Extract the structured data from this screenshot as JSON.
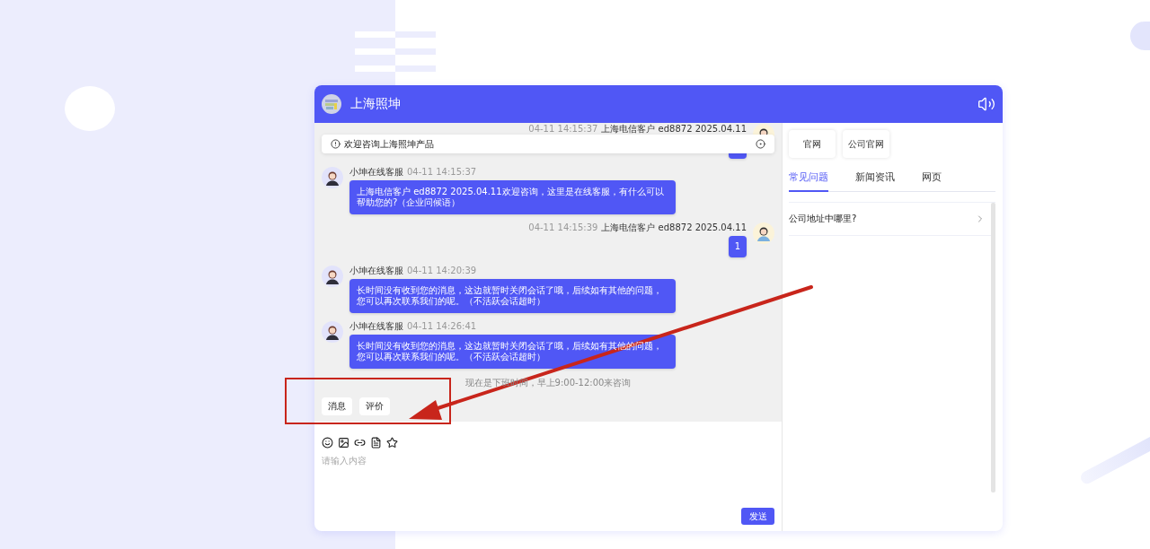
{
  "header": {
    "title": "上海照坤"
  },
  "notice": {
    "text": "欢迎咨询上海照坤产品"
  },
  "messages": [
    {
      "kind": "user",
      "time": "04-11 14:15:37",
      "sender": "上海电信客户 ed8872 2025.04.11"
    },
    {
      "kind": "agent",
      "sender": "小坤在线客服",
      "time": "04-11 14:15:37",
      "text": "上海电信客户 ed8872 2025.04.11欢迎咨询，这里是在线客服，有什么可以帮助您的?（企业问候语）"
    },
    {
      "kind": "user",
      "time": "04-11 14:15:39",
      "sender": "上海电信客户 ed8872 2025.04.11",
      "text": "1"
    },
    {
      "kind": "agent",
      "sender": "小坤在线客服",
      "time": "04-11 14:20:39",
      "text": "长时间没有收到您的消息，这边就暂时关闭会话了哦，后续如有其他的问题，您可以再次联系我们的呢。（不活跃会话超时）"
    },
    {
      "kind": "agent",
      "sender": "小坤在线客服",
      "time": "04-11 14:26:41",
      "text": "长时间没有收到您的消息，这边就暂时关闭会话了哦，后续如有其他的问题，您可以再次联系我们的呢。（不活跃会话超时）"
    },
    {
      "kind": "system",
      "text": "现在是下班时间，早上9:00-12:00来咨询"
    }
  ],
  "quick_buttons": [
    "消息",
    "评价"
  ],
  "composer": {
    "placeholder": "请输入内容",
    "send": "发送"
  },
  "side": {
    "links": [
      "官网",
      "公司官网"
    ],
    "tabs": [
      {
        "label": "常见问题",
        "selected": true
      },
      {
        "label": "新闻资讯",
        "selected": false
      },
      {
        "label": "网页",
        "selected": false
      }
    ],
    "faq": [
      {
        "question": "公司地址中哪里?"
      }
    ]
  }
}
